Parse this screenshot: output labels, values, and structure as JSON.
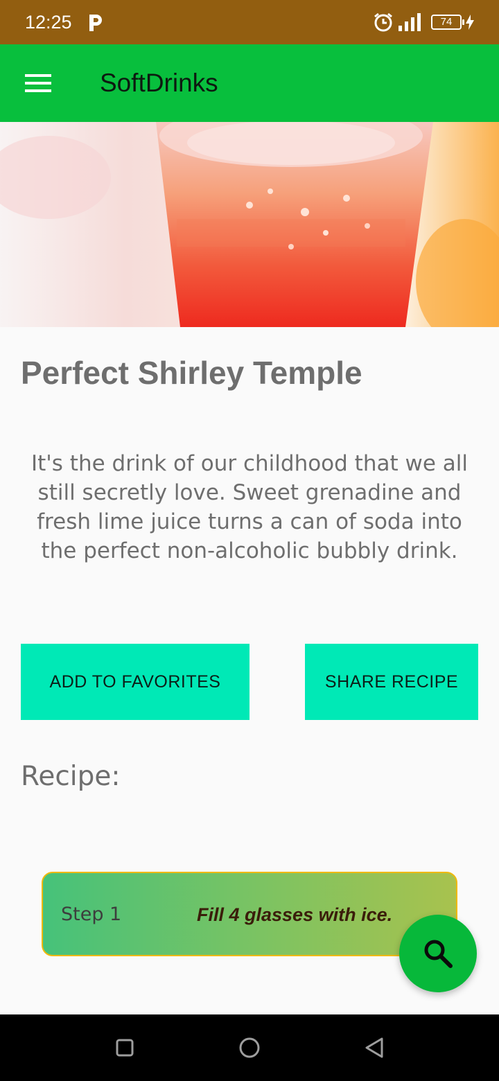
{
  "status_bar": {
    "time": "12:25",
    "battery_level": "74",
    "icons": [
      "parking-icon",
      "alarm-icon",
      "signal-icon",
      "battery-icon",
      "charging-icon"
    ]
  },
  "app_bar": {
    "title": "SoftDrinks",
    "menu_icon": "hamburger-menu-icon"
  },
  "hero_image": {
    "subject": "pink-orange drink in glass with ice"
  },
  "recipe": {
    "title": "Perfect Shirley Temple",
    "description": "It's the drink of our childhood that we all still secretly love. Sweet grenadine and fresh lime juice turns a can of soda into the perfect non-alcoholic bubbly drink.",
    "label": "Recipe:"
  },
  "buttons": {
    "favorites": "ADD TO FAVORITES",
    "share": "SHARE RECIPE"
  },
  "steps": [
    {
      "number": "Step 1",
      "text": "Fill 4 glasses with ice."
    }
  ],
  "fab": {
    "icon": "search-icon"
  },
  "nav_bar": {
    "icons": [
      "recents-square-icon",
      "home-circle-icon",
      "back-triangle-icon"
    ]
  },
  "colors": {
    "status_bar": "#925e10",
    "app_bar": "#08bf3d",
    "button": "#00e9b6",
    "fab": "#07b83a",
    "card_border": "#f0b90c"
  }
}
